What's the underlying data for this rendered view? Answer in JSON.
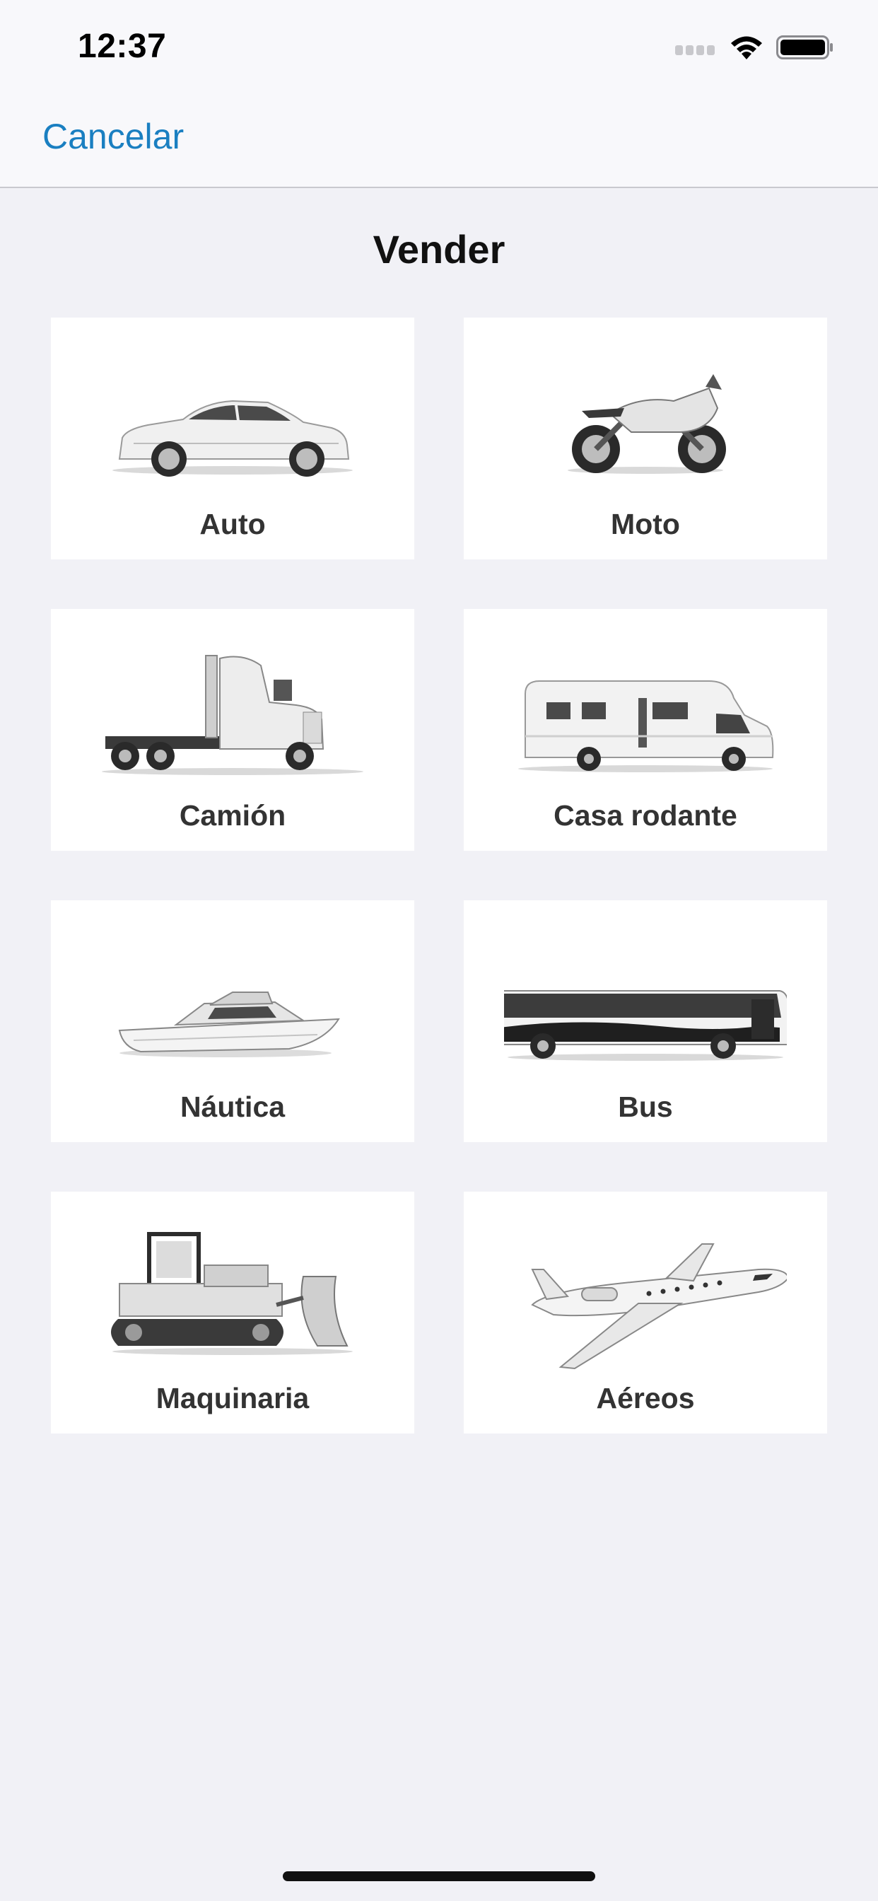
{
  "status_bar": {
    "time": "12:37"
  },
  "nav": {
    "cancel_label": "Cancelar"
  },
  "page": {
    "title": "Vender"
  },
  "categories": [
    {
      "label": "Auto",
      "icon": "car-icon"
    },
    {
      "label": "Moto",
      "icon": "motorcycle-icon"
    },
    {
      "label": "Camión",
      "icon": "truck-icon"
    },
    {
      "label": "Casa rodante",
      "icon": "motorhome-icon"
    },
    {
      "label": "Náutica",
      "icon": "boat-icon"
    },
    {
      "label": "Bus",
      "icon": "bus-icon"
    },
    {
      "label": "Maquinaria",
      "icon": "bulldozer-icon"
    },
    {
      "label": "Aéreos",
      "icon": "airplane-icon"
    }
  ],
  "colors": {
    "accent": "#1a7fc1",
    "background": "#f1f1f6",
    "tile": "#ffffff"
  }
}
